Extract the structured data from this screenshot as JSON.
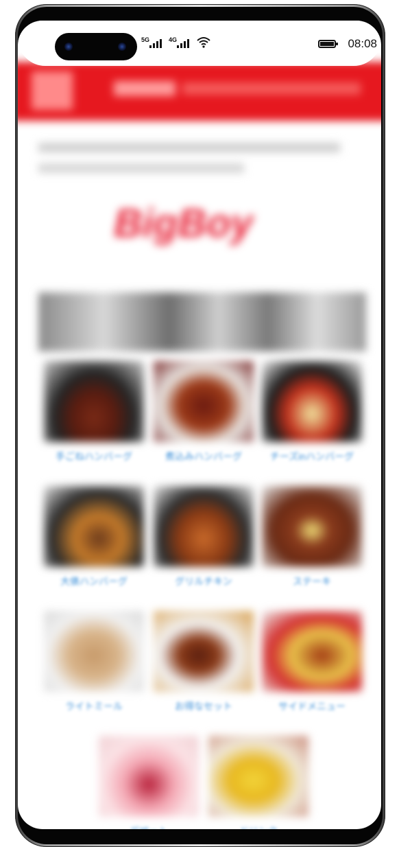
{
  "status_bar": {
    "network_1": "5G",
    "network_2": "4G",
    "time": "08:08",
    "icons": [
      "camera-icon",
      "signal-5g-icon",
      "signal-4g-icon",
      "wifi-icon",
      "battery-icon"
    ]
  },
  "page": {
    "brand": "BigBoy",
    "header_color": "#e6181f",
    "link_color": "#3b8fd8"
  },
  "menu": [
    {
      "label": "手ごねハンバーグ",
      "thumb": "t-burger"
    },
    {
      "label": "煮込みハンバーグ",
      "thumb": "t-stew"
    },
    {
      "label": "チーズinハンバーグ",
      "thumb": "t-cheese"
    },
    {
      "label": "大俵ハンバーグ",
      "thumb": "t-combo"
    },
    {
      "label": "グリルチキン",
      "thumb": "t-chicken"
    },
    {
      "label": "ステーキ",
      "thumb": "t-steak"
    },
    {
      "label": "ライトミール",
      "thumb": "t-pasta"
    },
    {
      "label": "お得なセット",
      "thumb": "t-curry"
    },
    {
      "label": "サイドメニュー",
      "thumb": "t-side"
    },
    {
      "label": "デザート",
      "thumb": "t-dessert"
    },
    {
      "label": "ドリンク",
      "thumb": "t-drink"
    }
  ]
}
